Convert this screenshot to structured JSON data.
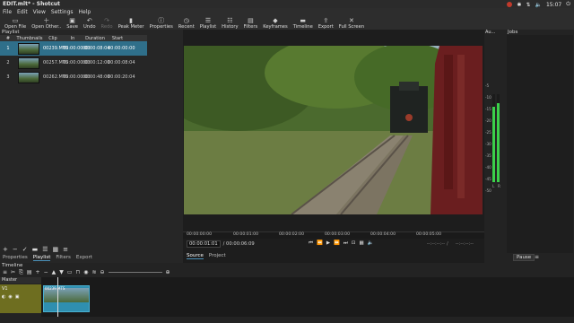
{
  "window": {
    "title": "EDIT.mlt* - Shotcut",
    "time": "15:07"
  },
  "menu": [
    "File",
    "Edit",
    "View",
    "Settings",
    "Help"
  ],
  "toolbar": [
    {
      "label": "Open File",
      "icon": "folder-icon",
      "enabled": true
    },
    {
      "label": "Open Other..",
      "icon": "open-other-icon",
      "enabled": true
    },
    {
      "label": "Save",
      "icon": "save-icon",
      "enabled": true
    },
    {
      "label": "Undo",
      "icon": "undo-icon",
      "enabled": true
    },
    {
      "label": "Redo",
      "icon": "redo-icon",
      "enabled": false
    },
    {
      "label": "Peak Meter",
      "icon": "peak-meter-icon",
      "enabled": true
    },
    {
      "label": "Properties",
      "icon": "info-icon",
      "enabled": true
    },
    {
      "label": "Recent",
      "icon": "clock-icon",
      "enabled": true
    },
    {
      "label": "Playlist",
      "icon": "playlist-icon",
      "enabled": true
    },
    {
      "label": "History",
      "icon": "history-icon",
      "enabled": true
    },
    {
      "label": "Filters",
      "icon": "filters-icon",
      "enabled": true
    },
    {
      "label": "Keyframes",
      "icon": "keyframes-icon",
      "enabled": true
    },
    {
      "label": "Timeline",
      "icon": "timeline-icon",
      "enabled": true
    },
    {
      "label": "Export",
      "icon": "export-icon",
      "enabled": true
    },
    {
      "label": "Full Screen",
      "icon": "fullscreen-icon",
      "enabled": true
    }
  ],
  "playlist": {
    "title": "Playlist",
    "columns": [
      "#",
      "Thumbnails",
      "Clip",
      "In",
      "Duration",
      "Start"
    ],
    "rows": [
      {
        "num": "1",
        "clip": "00239.MTS",
        "in": "00:00:00:00",
        "duration": "00:00:08:04",
        "start": "00:00:00:00",
        "selected": true
      },
      {
        "num": "2",
        "clip": "00257.MTS",
        "in": "00:00:00:00",
        "duration": "00:00:12:00",
        "start": "00:00:08:04",
        "selected": false
      },
      {
        "num": "3",
        "clip": "00262.MTS",
        "in": "00:00:00:00",
        "duration": "00:00:48:00",
        "start": "00:00:20:04",
        "selected": false
      }
    ],
    "tabs": [
      "Properties",
      "Playlist",
      "Filters",
      "Export"
    ],
    "active_tab": "Playlist"
  },
  "viewer": {
    "ruler_ticks": [
      "00:00:00:00",
      "00:00:01:00",
      "00:00:02:00",
      "00:00:03:00",
      "00:00:04:00",
      "00:00:05:00"
    ],
    "position": "00:00:01:01",
    "duration": "/ 00:00:06:09",
    "in_point": "--:--:--:--",
    "in_sep": "/",
    "out_point": "--:--:--:--",
    "tabs": [
      "Source",
      "Project"
    ],
    "active_tab": "Source"
  },
  "audio": {
    "title": "Au...",
    "scale": [
      "-5",
      "-10",
      "-15",
      "-20",
      "-25",
      "-30",
      "-35",
      "-40",
      "-45",
      "-50"
    ],
    "left_label": "L",
    "right_label": "R",
    "left_level": 0.86,
    "right_level": 0.9
  },
  "jobs": {
    "title": "Jobs",
    "pause_label": "Pause",
    "menu_label": "≡"
  },
  "timeline": {
    "title": "Timeline",
    "master_label": "Master",
    "track_label": "V1",
    "clip_label": "00239.MTS"
  }
}
